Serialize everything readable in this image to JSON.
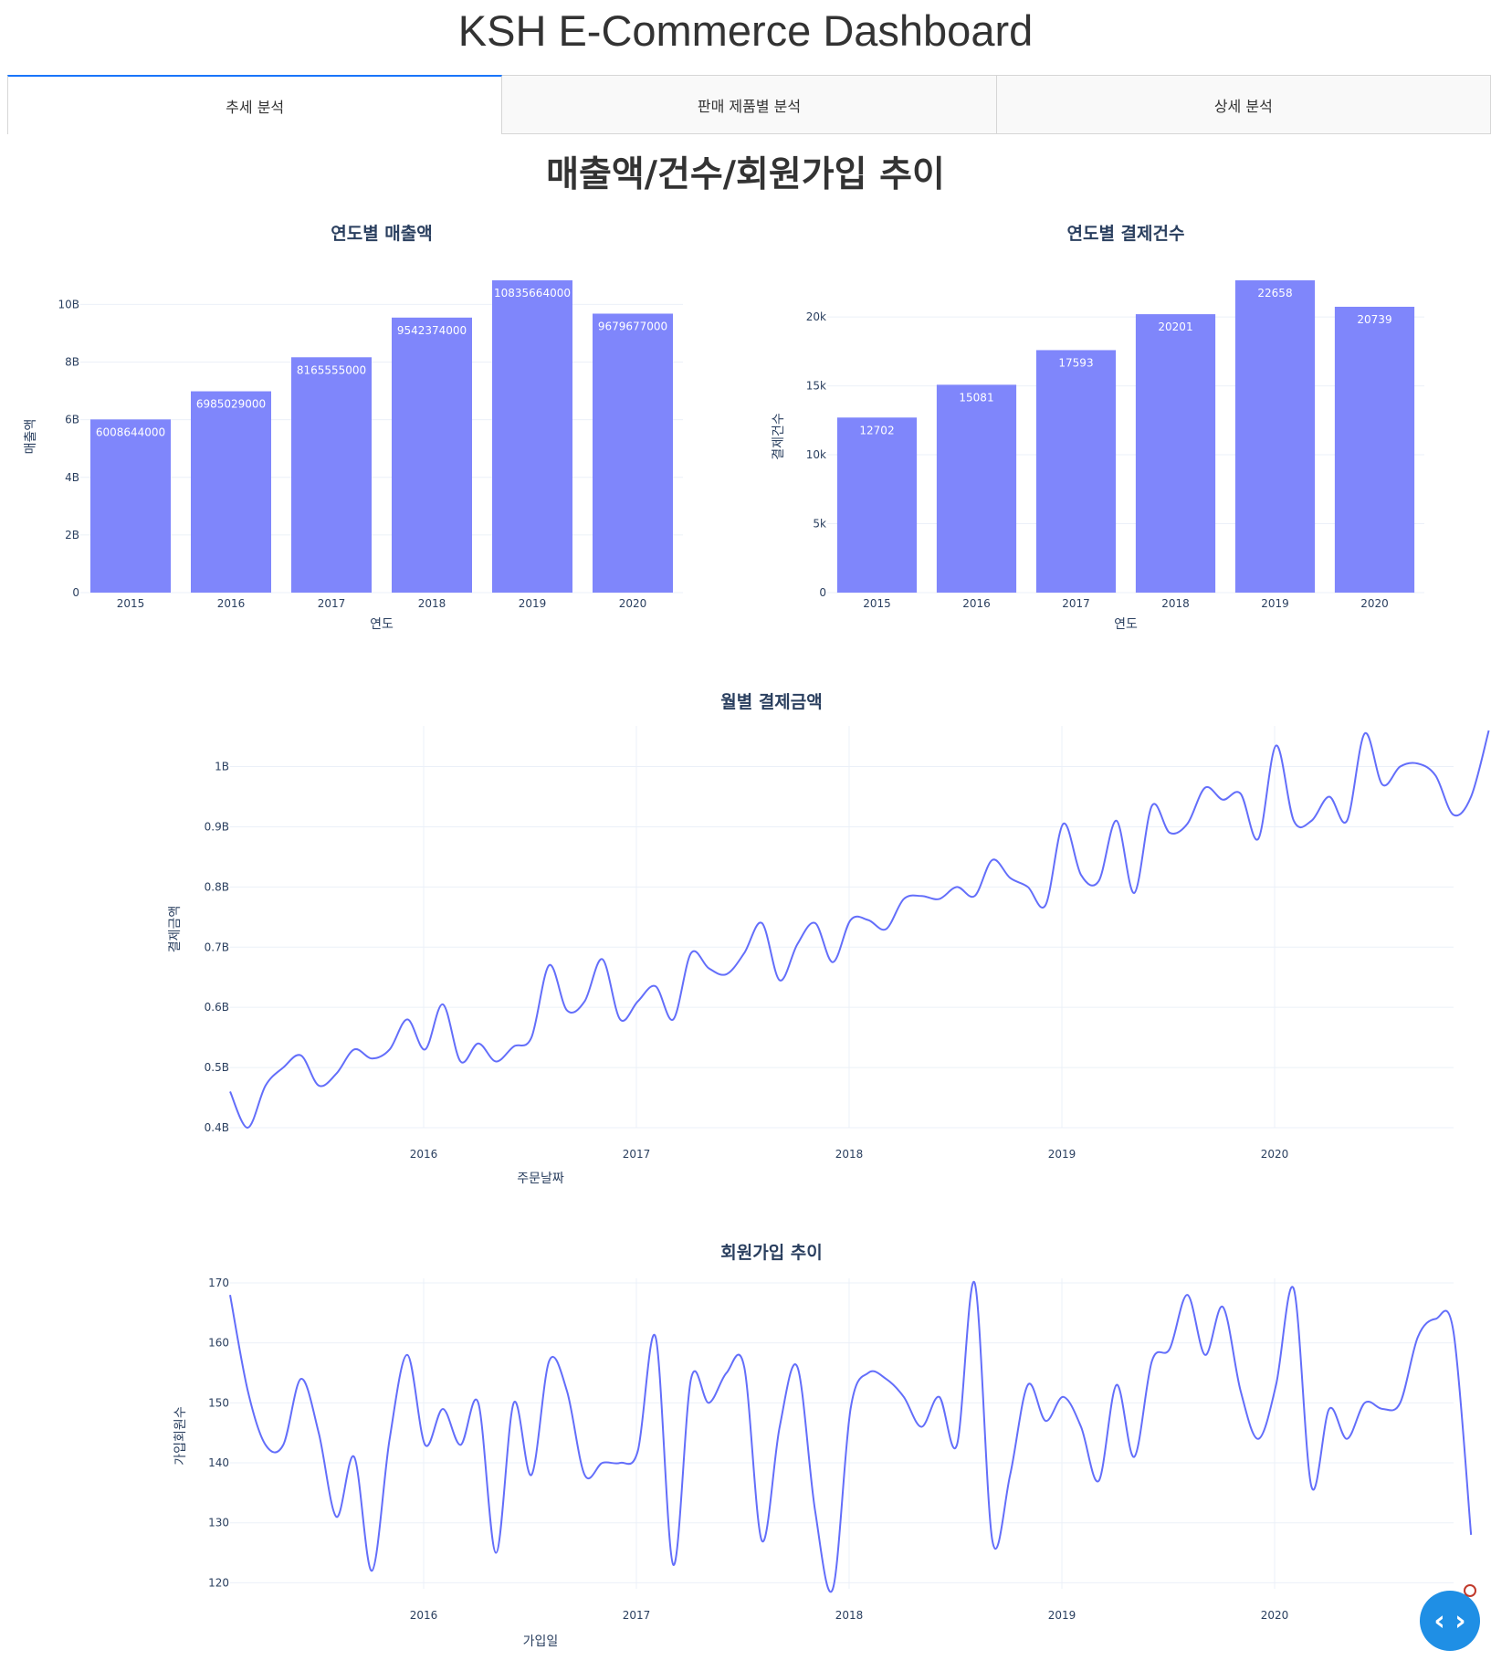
{
  "app": {
    "title": "KSH E-Commerce Dashboard",
    "tabs": [
      {
        "label": "추세 분석",
        "active": true
      },
      {
        "label": "판매 제품별 분석",
        "active": false
      },
      {
        "label": "상세 분석",
        "active": false
      }
    ],
    "section_title": "매출액/건수/회원가입 추이",
    "accent_color": "#1975fa",
    "bar_color": "#7f86fb",
    "line_color": "#636efa",
    "fab_icon": "code-icon"
  },
  "chart_data": [
    {
      "type": "bar",
      "title": "연도별 매출액",
      "xlabel": "연도",
      "ylabel": "매출액",
      "categories": [
        "2015",
        "2016",
        "2017",
        "2018",
        "2019",
        "2020"
      ],
      "values": [
        6008644000,
        6985029000,
        8165555000,
        9542374000,
        10835664000,
        9679677000
      ],
      "yticks": [
        0,
        2000000000,
        4000000000,
        6000000000,
        8000000000,
        10000000000
      ],
      "ytick_labels": [
        "0",
        "2B",
        "4B",
        "6B",
        "8B",
        "10B"
      ],
      "ylim": [
        0,
        10835664000
      ],
      "data_labels": [
        "6008644000",
        "6985029000",
        "8165555000",
        "9542374000",
        "10835664000",
        "9679677000"
      ]
    },
    {
      "type": "bar",
      "title": "연도별 결제건수",
      "xlabel": "연도",
      "ylabel": "결제건수",
      "categories": [
        "2015",
        "2016",
        "2017",
        "2018",
        "2019",
        "2020"
      ],
      "values": [
        12702,
        15081,
        17593,
        20201,
        22658,
        20739
      ],
      "yticks": [
        0,
        5000,
        10000,
        15000,
        20000
      ],
      "ytick_labels": [
        "0",
        "5k",
        "10k",
        "15k",
        "20k"
      ],
      "ylim": [
        0,
        22658
      ],
      "data_labels": [
        "12702",
        "15081",
        "17593",
        "20201",
        "22658",
        "20739"
      ]
    },
    {
      "type": "line",
      "title": "월별 결제금액",
      "xlabel": "주문날짜",
      "ylabel": "결제금액",
      "xstart": "2015-01",
      "xticks": [
        "2016",
        "2017",
        "2018",
        "2019",
        "2020"
      ],
      "ytick_labels": [
        "0.4B",
        "0.5B",
        "0.6B",
        "0.7B",
        "0.8B",
        "0.9B",
        "1B"
      ],
      "yticks": [
        0.4,
        0.5,
        0.6,
        0.7,
        0.8,
        0.9,
        1.0
      ],
      "ylim": [
        0.4,
        1.06
      ],
      "series": [
        {
          "values": [
            0.46,
            0.4,
            0.47,
            0.5,
            0.52,
            0.47,
            0.49,
            0.53,
            0.515,
            0.53,
            0.58,
            0.53,
            0.605,
            0.51,
            0.54,
            0.51,
            0.535,
            0.55,
            0.67,
            0.595,
            0.61,
            0.68,
            0.58,
            0.61,
            0.635,
            0.58,
            0.69,
            0.665,
            0.655,
            0.69,
            0.74,
            0.645,
            0.705,
            0.74,
            0.675,
            0.745,
            0.745,
            0.73,
            0.78,
            0.785,
            0.78,
            0.8,
            0.785,
            0.845,
            0.815,
            0.8,
            0.77,
            0.905,
            0.82,
            0.81,
            0.91,
            0.79,
            0.935,
            0.89,
            0.905,
            0.965,
            0.945,
            0.955,
            0.88,
            1.035,
            0.91,
            0.91,
            0.95,
            0.91,
            1.055,
            0.97,
            1.0,
            1.005,
            0.985,
            0.92,
            0.95,
            1.06
          ]
        }
      ]
    },
    {
      "type": "line",
      "title": "회원가입 추이",
      "xlabel": "가입일",
      "ylabel": "가입회원수",
      "xstart": "2015-01",
      "xticks": [
        "2016",
        "2017",
        "2018",
        "2019",
        "2020"
      ],
      "ytick_labels": [
        "120",
        "130",
        "140",
        "150",
        "160",
        "170"
      ],
      "yticks": [
        120,
        130,
        140,
        150,
        160,
        170
      ],
      "ylim": [
        119,
        170
      ],
      "series": [
        {
          "values": [
            168,
            152,
            143,
            143,
            154,
            145,
            131,
            141,
            122,
            144,
            158,
            143,
            149,
            143,
            150,
            125,
            150,
            138,
            157,
            152,
            138,
            140,
            140,
            142,
            161,
            123,
            154,
            150,
            155,
            156,
            127,
            146,
            156,
            132,
            119,
            149,
            155,
            154,
            151,
            146,
            151,
            143,
            170,
            127,
            138,
            153,
            147,
            151,
            146,
            137,
            153,
            141,
            157,
            159,
            168,
            158,
            166,
            152,
            144,
            153,
            169,
            136,
            149,
            144,
            150,
            149,
            150,
            161,
            164,
            162,
            128
          ]
        }
      ]
    }
  ]
}
